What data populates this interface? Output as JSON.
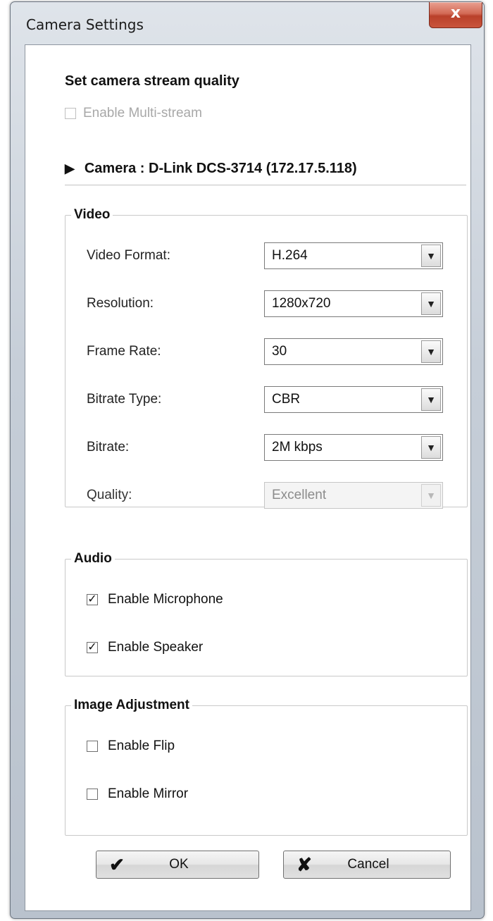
{
  "window": {
    "title": "Camera Settings",
    "close_glyph": "x"
  },
  "stream": {
    "heading": "Set camera stream quality",
    "multi_stream_label": "Enable Multi-stream",
    "multi_stream_checked": false,
    "multi_stream_enabled": false,
    "camera_label": "Camera : D-Link DCS-3714 (172.17.5.118)",
    "camera_marker_icon": "triangle-right-icon"
  },
  "video": {
    "legend": "Video",
    "rows": [
      {
        "label": "Video Format:",
        "value": "H.264"
      },
      {
        "label": "Resolution:",
        "value": "1280x720"
      },
      {
        "label": "Frame Rate:",
        "value": "30"
      },
      {
        "label": "Bitrate Type:",
        "value": "CBR"
      },
      {
        "label": "Bitrate:",
        "value": "2M kbps"
      },
      {
        "label": "Quality:",
        "value": "Excellent",
        "disabled": true
      }
    ]
  },
  "audio": {
    "legend": "Audio",
    "microphone_label": "Enable Microphone",
    "microphone_checked": true,
    "speaker_label": "Enable Speaker",
    "speaker_checked": true
  },
  "image": {
    "legend": "Image Adjustment",
    "flip_label": "Enable Flip",
    "flip_checked": false,
    "mirror_label": "Enable Mirror",
    "mirror_checked": false
  },
  "buttons": {
    "ok_label": "OK",
    "ok_icon": "checkmark-icon",
    "cancel_label": "Cancel",
    "cancel_icon": "x-icon"
  },
  "colors": {
    "close_button": "#c9553d",
    "window_frame": "#c6ced8"
  }
}
